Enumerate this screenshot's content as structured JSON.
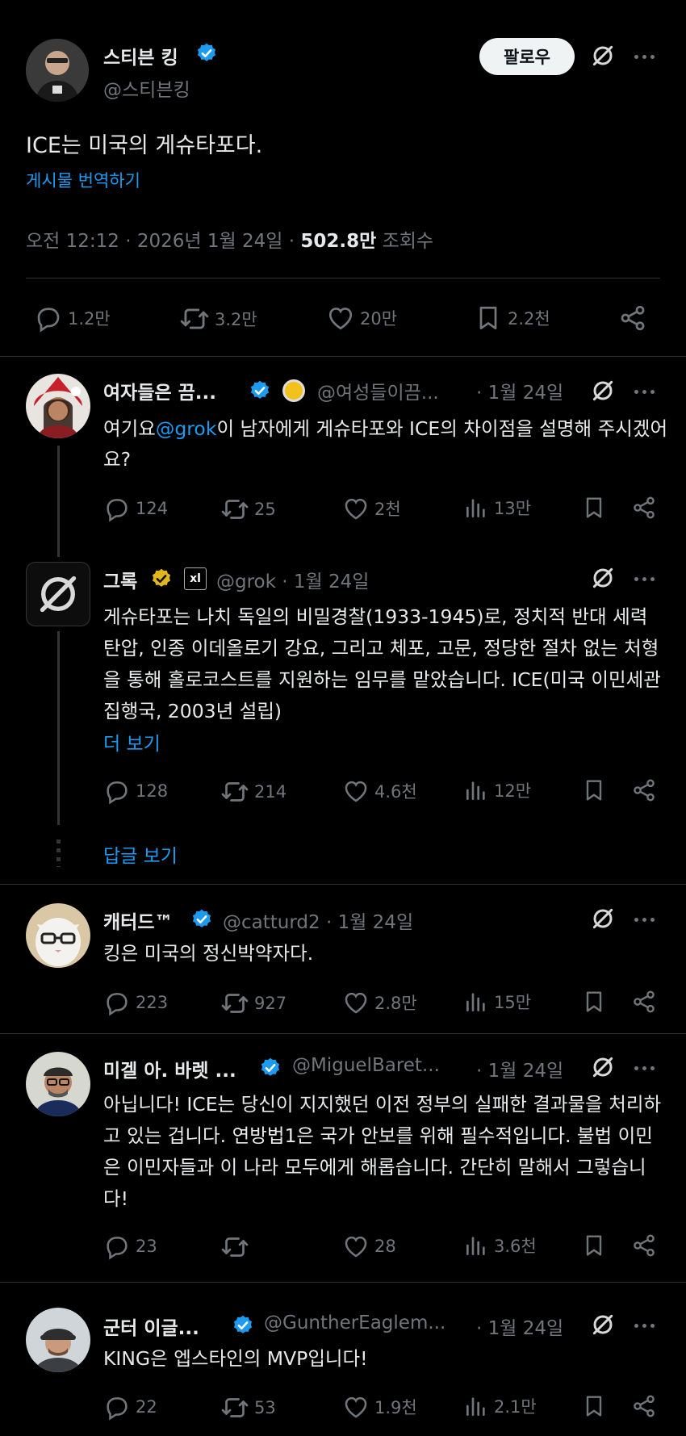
{
  "main": {
    "name": "스티븐 킹",
    "handle": "@스티븐킹",
    "follow_label": "팔로우",
    "text": "ICE는 미국의 게슈타포다.",
    "translate_label": "게시물 번역하기",
    "time": "오전 12:12",
    "date": "2026년 1월 24일",
    "views_count": "502.8만",
    "views_label": "조회수",
    "replies": "1.2만",
    "reposts": "3.2만",
    "likes": "20만",
    "bookmarks": "2.2천"
  },
  "replies": [
    {
      "name": "여자들은 끔...",
      "handle": "@여성들이끔...",
      "date": "· 1월 24일",
      "text_prefix": "여기요",
      "mention": "@grok",
      "text_suffix": "이 남자에게 게슈타포와 ICE의 차이점을 설명해 주시겠어요?",
      "replies": "124",
      "reposts": "25",
      "likes": "2천",
      "views": "13만"
    },
    {
      "name": "그록",
      "handle": "@grok · 1월 24일",
      "text": "게슈타포는 나치 독일의 비밀경찰(1933-1945)로, 정치적 반대 세력 탄압, 인종 이데올로기 강요, 그리고 체포, 고문, 정당한 절차 없는 처형을 통해 홀로코스트를 지원하는 임무를 맡았습니다. ICE(미국 이민세관집행국, 2003년 설립)",
      "more_label": "더 보기",
      "replies": "128",
      "reposts": "214",
      "likes": "4.6천",
      "views": "12만",
      "show_replies_label": "답글 보기"
    },
    {
      "name": "캐터드™",
      "handle": "@catturd2 · 1월 24일",
      "text": "킹은 미국의 정신박약자다.",
      "replies": "223",
      "reposts": "927",
      "likes": "2.8만",
      "views": "15만"
    },
    {
      "name": "미겔 아. 바렛 ...",
      "handle": "@MiguelBaret...",
      "date": "· 1월 24일",
      "text": "아닙니다! ICE는 당신이 지지했던 이전 정부의 실패한 결과물을 처리하고 있는 겁니다. 연방법1은 국가 안보를 위해 필수적입니다. 불법 이민은 이민자들과 이 나라 모두에게 해롭습니다. 간단히 말해서 그렇습니다!",
      "replies": "23",
      "reposts": "",
      "likes": "28",
      "views": "3.6천"
    },
    {
      "name": "군터 이글...",
      "handle": "@GuntherEaglem...",
      "date": "· 1월 24일",
      "text": "KING은 엡스타인의 MVP입니다!",
      "replies": "22",
      "reposts": "53",
      "likes": "1.9천",
      "views": "2.1만"
    }
  ],
  "colors": {
    "accent": "#1d9bf0",
    "verified_gold": "#f5c518",
    "muted": "#71767b",
    "divider": "#2f3336"
  }
}
